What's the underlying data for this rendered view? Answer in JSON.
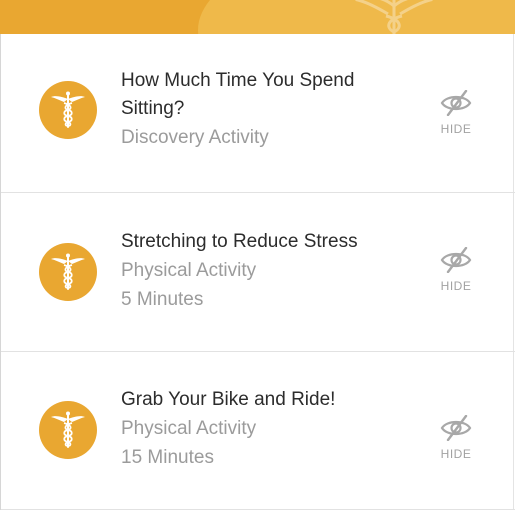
{
  "accent_color": "#e9a731",
  "header": {
    "emblem_icon": "caduceus-icon"
  },
  "activities": [
    {
      "title_lines": [
        "How Much Time You Spend",
        "Sitting?"
      ],
      "category": "Discovery Activity",
      "duration": "",
      "icon": "caduceus-icon",
      "hide_label": "HIDE",
      "hide_icon": "eye-slash-icon"
    },
    {
      "title_lines": [
        "Stretching to Reduce Stress"
      ],
      "category": "Physical Activity",
      "duration": "5 Minutes",
      "icon": "caduceus-icon",
      "hide_label": "HIDE",
      "hide_icon": "eye-slash-icon"
    },
    {
      "title_lines": [
        "Grab Your Bike and Ride!"
      ],
      "category": "Physical Activity",
      "duration": "15 Minutes",
      "icon": "caduceus-icon",
      "hide_label": "HIDE",
      "hide_icon": "eye-slash-icon"
    }
  ]
}
